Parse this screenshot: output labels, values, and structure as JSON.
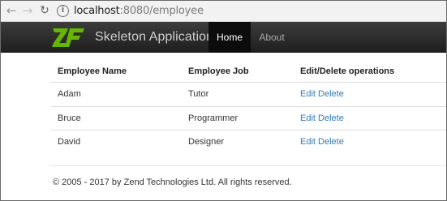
{
  "browser": {
    "url_host": "localhost",
    "url_rest": ":8080/employee"
  },
  "navbar": {
    "brand": "Skeleton Application",
    "items": [
      {
        "label": "Home"
      },
      {
        "label": "About"
      }
    ]
  },
  "table": {
    "headers": [
      "Employee Name",
      "Employee Job",
      "Edit/Delete operations"
    ],
    "rows": [
      {
        "name": "Adam",
        "job": "Tutor",
        "edit": "Edit",
        "delete": "Delete"
      },
      {
        "name": "Bruce",
        "job": "Programmer",
        "edit": "Edit",
        "delete": "Delete"
      },
      {
        "name": "David",
        "job": "Designer",
        "edit": "Edit",
        "delete": "Delete"
      }
    ]
  },
  "footer": {
    "text": "© 2005 - 2017 by Zend Technologies Ltd. All rights reserved."
  },
  "colors": {
    "link": "#337ab7",
    "navbar": "#2b2b2b",
    "logo_green": "#68b604"
  }
}
